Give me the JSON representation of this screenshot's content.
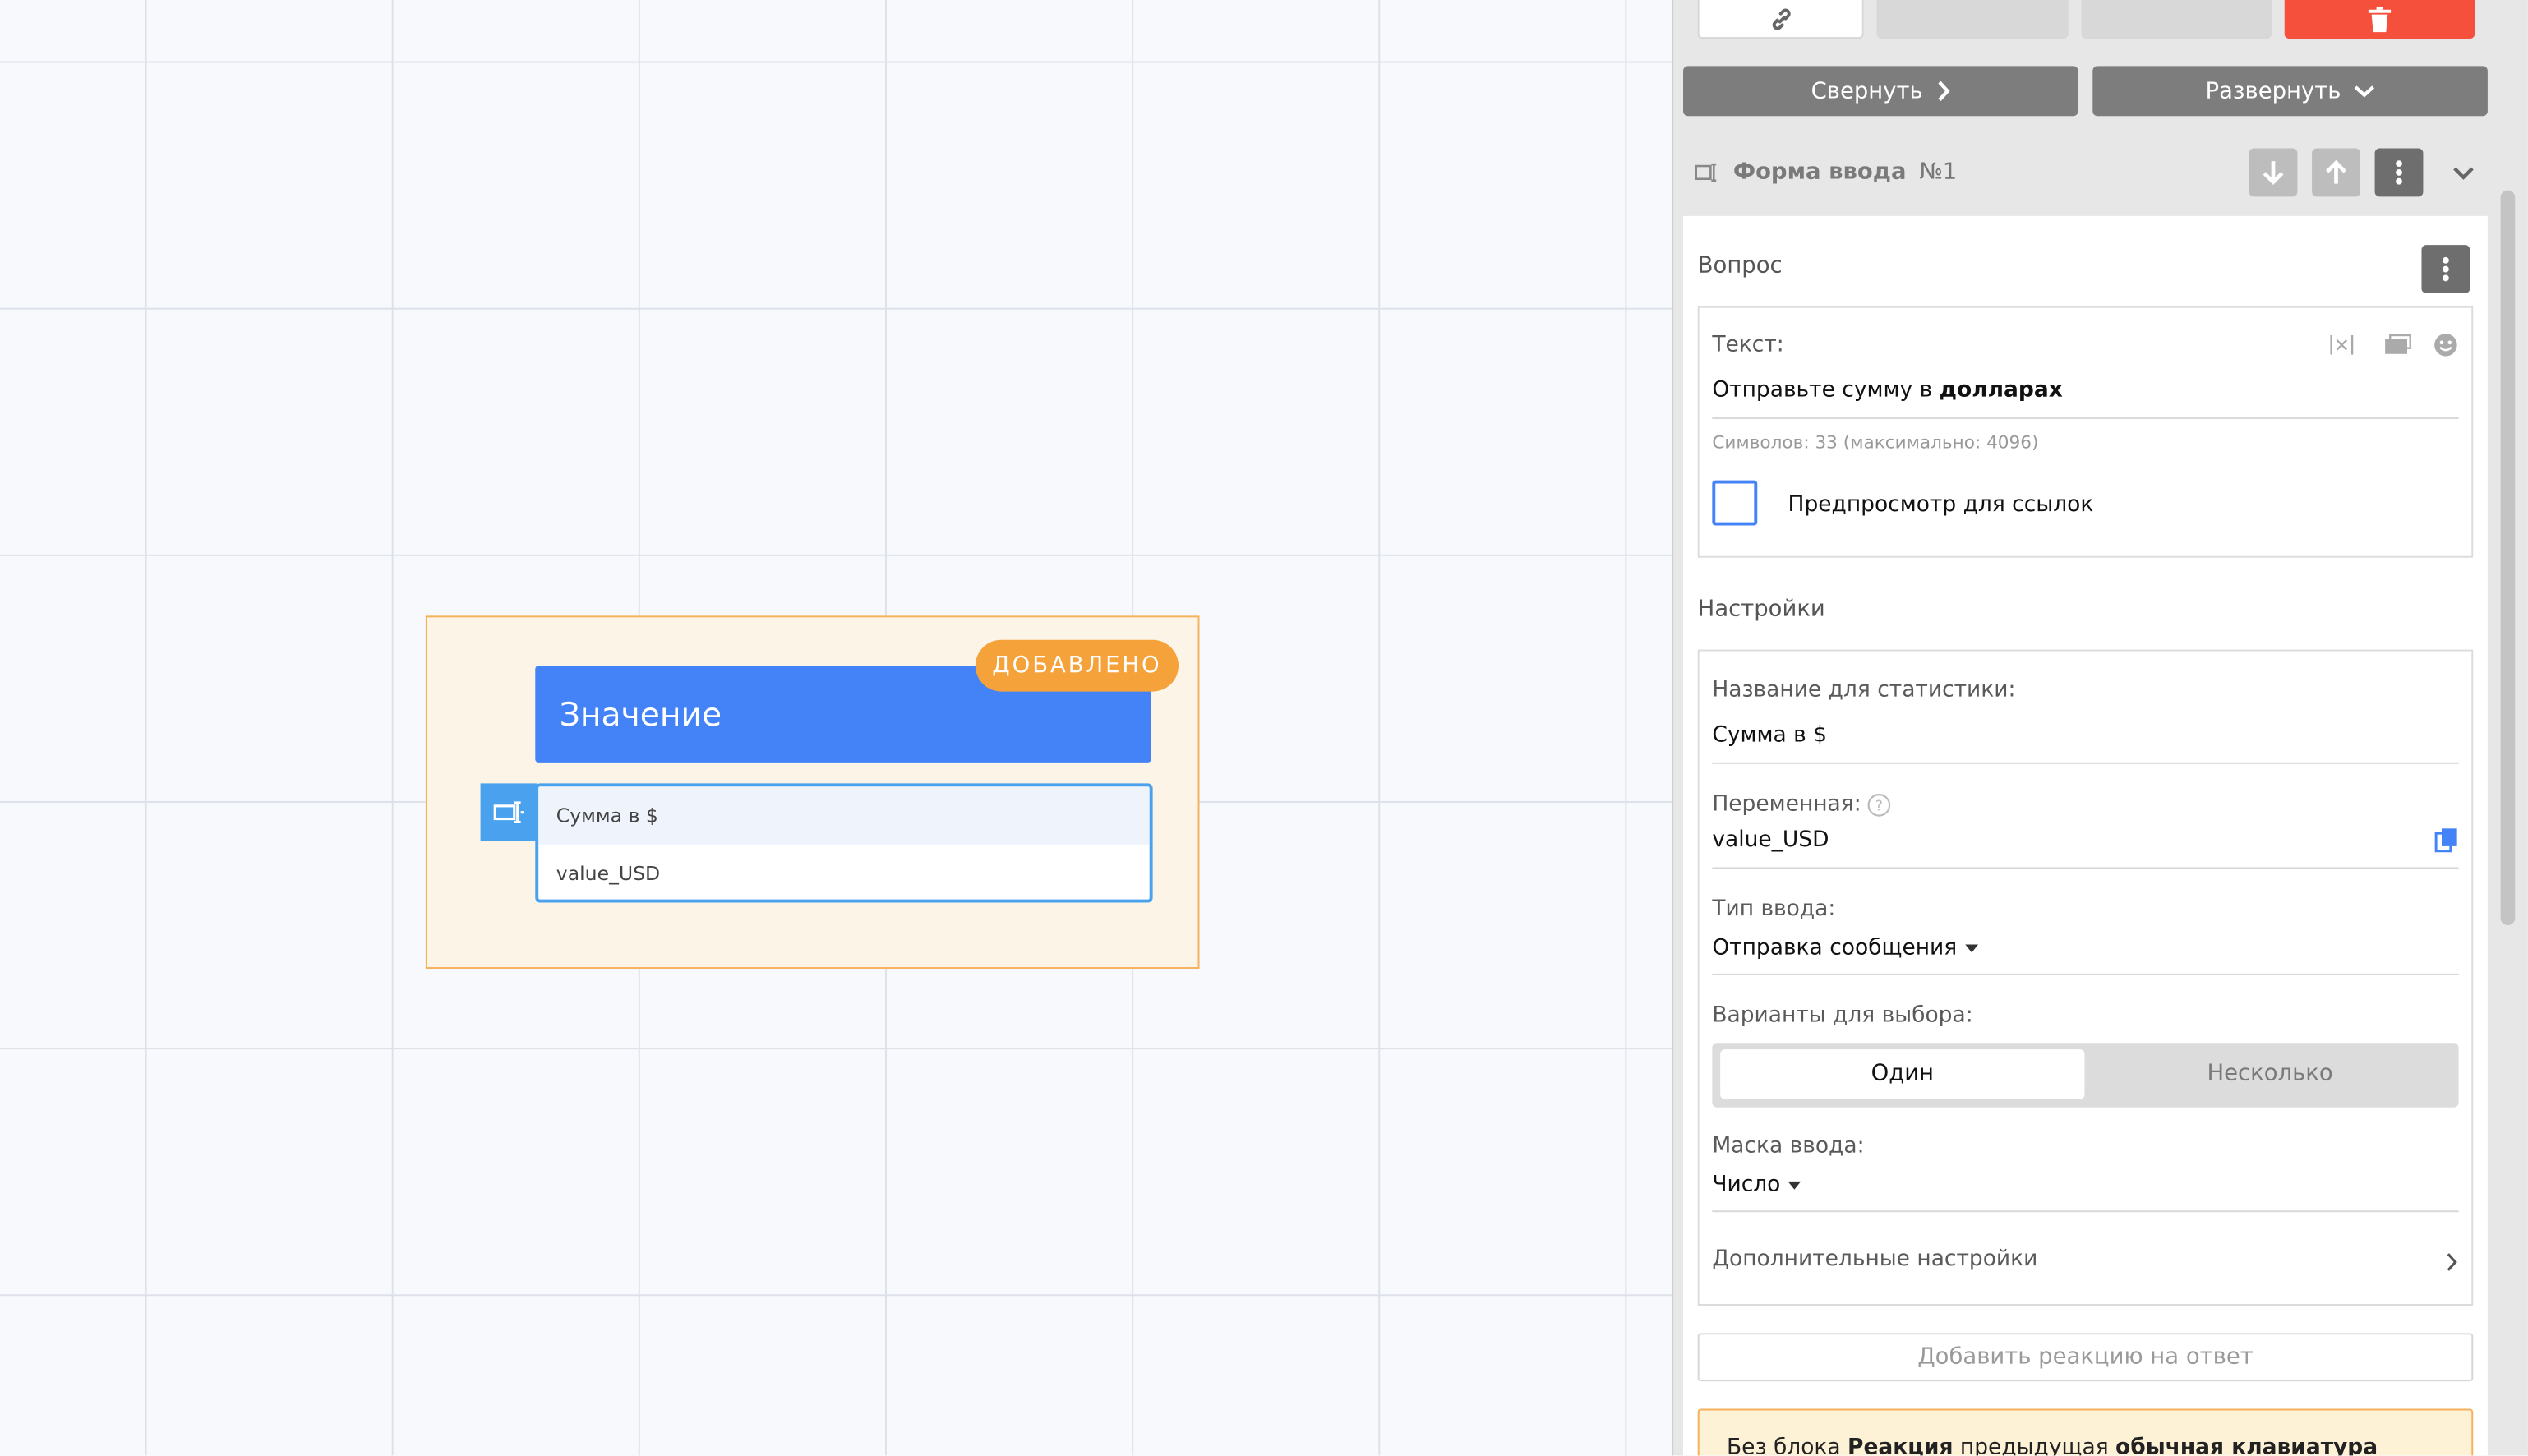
{
  "canvas": {
    "node": {
      "title": "Значение",
      "badge": "ДОБАВЛЕНО",
      "rows": [
        "Сумма в $",
        "value_USD"
      ]
    }
  },
  "panel": {
    "top_buttons": {
      "collapse_label": "Свернуть",
      "expand_label": "Развернуть"
    },
    "form": {
      "title": "Форма ввода",
      "number": "№1"
    },
    "question": {
      "section_label": "Вопрос",
      "text_label": "Текст:",
      "text_value_prefix": "Отправьте сумму в ",
      "text_value_bold": "долларах",
      "char_count": "Символов: 33 (максимально: 4096)",
      "link_preview_label": "Предпросмотр для ссылок"
    },
    "settings": {
      "section_label": "Настройки",
      "stat_name_label": "Название для статистики:",
      "stat_name_value": "Сумма в $",
      "variable_label": "Переменная:",
      "variable_value": "value_USD",
      "input_type_label": "Тип ввода:",
      "input_type_value": "Отправка сообщения",
      "choice_label": "Варианты для выбора:",
      "choice_options": [
        "Один",
        "Несколько"
      ],
      "mask_label": "Маска ввода:",
      "mask_value": "Число",
      "advanced_label": "Дополнительные настройки"
    },
    "add_reaction_label": "Добавить реакцию на ответ",
    "note": {
      "part1": "Без блока ",
      "bold1": "Реакция",
      "part2": " предыдущая ",
      "bold2": "обычная клавиатура"
    }
  },
  "colors": {
    "accent_blue": "#4383f7",
    "badge_orange": "#f6a23b",
    "delete_red": "#f5503c",
    "button_gray": "#7d7d7d"
  }
}
